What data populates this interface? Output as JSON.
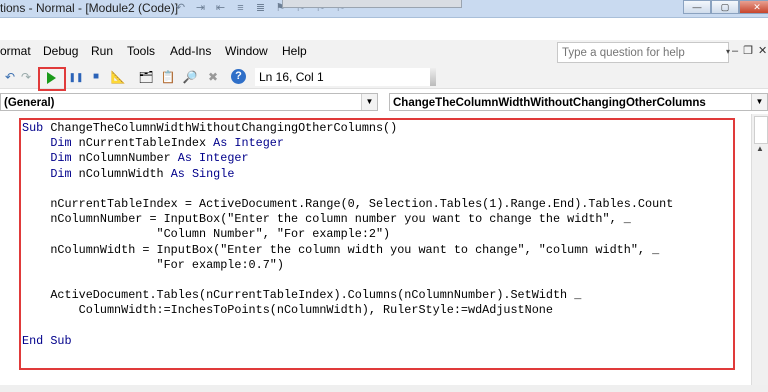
{
  "titlebar": {
    "text": "tions - Normal - [Module2 (Code)]",
    "qat_icons": [
      "undo-icon",
      "indent-icon",
      "outdent-icon",
      "comment-icon",
      "uncomment-icon",
      "toggle-bookmark-icon",
      "next-bookmark-icon",
      "prev-bookmark-icon",
      "clear-bookmarks-icon"
    ]
  },
  "window_buttons": {
    "minimize": "—",
    "restore": "▢",
    "close": "✕"
  },
  "menu": {
    "items": [
      {
        "label": "ormat"
      },
      {
        "label": "Debug"
      },
      {
        "label": "Run"
      },
      {
        "label": "Tools"
      },
      {
        "label": "Add-Ins"
      },
      {
        "label": "Window"
      },
      {
        "label": "Help"
      }
    ]
  },
  "help_search": {
    "placeholder": "Type a question for help",
    "dropdown": "▾"
  },
  "mdi_buttons": {
    "minimize": "–",
    "restore": "❐",
    "close": "✕"
  },
  "toolbar": {
    "undo": "↶",
    "redo": "↷",
    "run_label": "Run Sub/UserForm",
    "break": "❚❚",
    "reset": "■",
    "design_mode": "📐",
    "project_explorer": "🗂",
    "properties": "📋",
    "object_browser": "🔎",
    "toolbox": "✖",
    "help": "?",
    "cursor_position": "Ln 16, Col 1"
  },
  "combos": {
    "object": "(General)",
    "procedure": "ChangeTheColumnWidthWithoutChangingOtherColumns",
    "arrow": "▼"
  },
  "code": {
    "l1_kw": "Sub",
    "l1": " ChangeTheColumnWidthWithoutChangingOtherColumns()",
    "l2_kw": "Dim",
    "l2_a": " nCurrentTableIndex ",
    "l2_kw2": "As Integer",
    "l3_kw": "Dim",
    "l3_a": " nColumnNumber ",
    "l3_kw2": "As Integer",
    "l4_kw": "Dim",
    "l4_a": " nColumnWidth ",
    "l4_kw2": "As Single",
    "l6": "nCurrentTableIndex = ActiveDocument.Range(0, Selection.Tables(1).Range.End).Tables.Count",
    "l7": "nColumnNumber = InputBox(\"Enter the column number you want to change the width\", _",
    "l8": "\"Column Number\", \"For example:2\")",
    "l9": "nColumnWidth = InputBox(\"Enter the column width you want to change\", \"column width\", _",
    "l10": "\"For example:0.7\")",
    "l12": "ActiveDocument.Tables(nCurrentTableIndex).Columns(nColumnNumber).SetWidth _",
    "l13": "ColumnWidth:=InchesToPoints(nColumnWidth), RulerStyle:=wdAdjustNone",
    "l15": "End Sub"
  },
  "colors": {
    "highlight": "#e03a3a",
    "keyword": "#00008b",
    "run_green": "#1a9a1a"
  }
}
